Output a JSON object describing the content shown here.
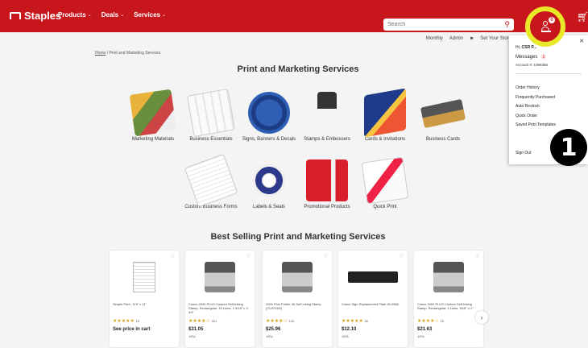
{
  "header": {
    "logo": "Staples",
    "nav": [
      {
        "label": "Products"
      },
      {
        "label": "Deals"
      },
      {
        "label": "Services"
      }
    ],
    "search_placeholder": "Search",
    "account_badge": "0"
  },
  "subbar": {
    "items": [
      "Monthly",
      "Admin",
      "Set Your Store"
    ]
  },
  "breadcrumb": {
    "home": "Home",
    "current": "Print and Marketing Services"
  },
  "page_title": "Print and Marketing Services",
  "categories": [
    {
      "label": "Marketing Materials"
    },
    {
      "label": "Business Essentials"
    },
    {
      "label": "Signs, Banners & Decals"
    },
    {
      "label": "Stamps & Embossers"
    },
    {
      "label": "Cards & Invitations"
    },
    {
      "label": "Business Cards"
    },
    {
      "label": "Custom Business Forms"
    },
    {
      "label": "Labels & Seals"
    },
    {
      "label": "Promotional Products"
    },
    {
      "label": "Quick Print"
    }
  ],
  "best_selling_title": "Best Selling Print and Marketing Services",
  "products": [
    {
      "name": "Simple Print - 8.5\" x 11\"",
      "rating": "★★★★★",
      "reviews": "15",
      "price": "See price in cart",
      "unit": ""
    },
    {
      "name": "Cosco 2000 PLUS Custom Self-Inking Stamp, Rectangular, 10 Lines, 1 3/16\" x 3 3/4\"",
      "rating": "★★★★☆",
      "reviews": "321",
      "price": "$31.05",
      "unit": "1/EA"
    },
    {
      "name": "2000 Plus Printer 40 Self Inking Stamp (CUSTOM)",
      "rating": "★★★★☆",
      "reviews": "120",
      "price": "$25.96",
      "unit": "1/EA"
    },
    {
      "name": "Cosco Sign Replacement Plate IN-0988",
      "rating": "★★★★★",
      "reviews": "30",
      "price": "$12.10",
      "unit": "1/EA"
    },
    {
      "name": "Cosco 2000 PLUS Custom Self-Inking Stamp, Rectangular, 3 Lines, 9/16\" x 1\"",
      "rating": "★★★★☆",
      "reviews": "15",
      "price": "$21.63",
      "unit": "1/EA"
    }
  ],
  "account_dropdown": {
    "greeting_prefix": "Hi,",
    "greeting_name": "CSR P...",
    "messages_label": "Messages",
    "messages_count": "1",
    "account_number": "Account #: 1096386",
    "menu": [
      "Order History",
      "Frequently Purchased",
      "Auto Restock",
      "Quick Order",
      "Saved Print Templates"
    ],
    "sign_out": "Sign Out"
  },
  "step_marker": "1",
  "colors": {
    "brand_red": "#c8161d",
    "highlight_yellow": "#e9e92a"
  }
}
